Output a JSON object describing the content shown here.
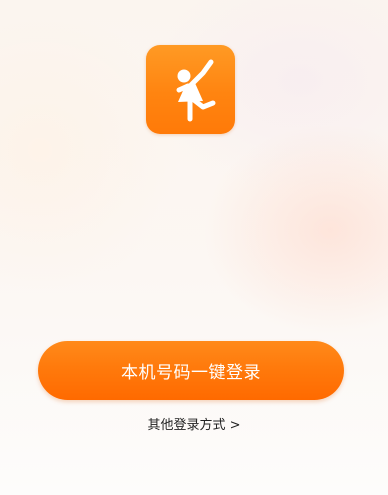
{
  "app": {
    "logo_icon": "dancing-person-icon",
    "brand_color": "#ff7a0c"
  },
  "login": {
    "one_tap_label": "本机号码一键登录",
    "other_methods_label": "其他登录方式 >"
  }
}
